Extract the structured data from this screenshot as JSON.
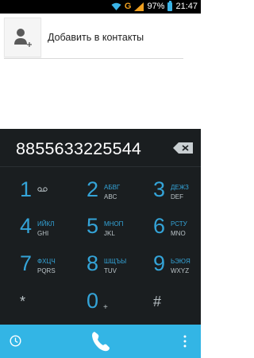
{
  "status_bar": {
    "battery_percent": "97%",
    "time": "21:47",
    "network_letter": "G"
  },
  "add_contact": {
    "label": "Добавить в контакты",
    "icon": "add-person-icon"
  },
  "dial": {
    "number": "8855633225544"
  },
  "keypad": [
    {
      "num": "1",
      "l1": "",
      "l2": ""
    },
    {
      "num": "2",
      "l1": "АБВГ",
      "l2": "ABC"
    },
    {
      "num": "3",
      "l1": "ДЕЖЗ",
      "l2": "DEF"
    },
    {
      "num": "4",
      "l1": "ИЙКЛ",
      "l2": "GHI"
    },
    {
      "num": "5",
      "l1": "МНОП",
      "l2": "JKL"
    },
    {
      "num": "6",
      "l1": "РСТУ",
      "l2": "MNO"
    },
    {
      "num": "7",
      "l1": "ФХЦЧ",
      "l2": "PQRS"
    },
    {
      "num": "8",
      "l1": "ШЩЪЫ",
      "l2": "TUV"
    },
    {
      "num": "9",
      "l1": "ЬЭЮЯ",
      "l2": "WXYZ"
    },
    {
      "num": "*",
      "l1": "",
      "l2": ""
    },
    {
      "num": "0",
      "l1": "",
      "l2": "+"
    },
    {
      "num": "#",
      "l1": "",
      "l2": ""
    }
  ],
  "colors": {
    "accent": "#33b5e5",
    "dialer_bg": "#1a1e20",
    "key_blue": "#34a4d8"
  }
}
